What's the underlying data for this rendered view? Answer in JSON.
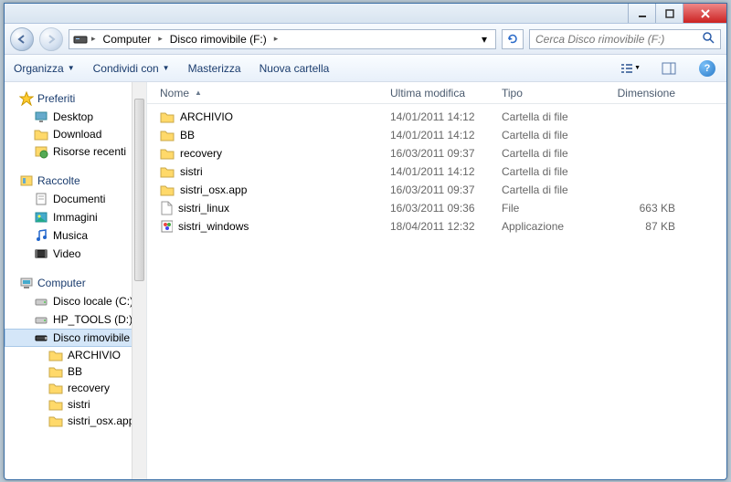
{
  "title_controls": {
    "min": "minimize",
    "max": "maximize",
    "close": "close"
  },
  "breadcrumb": {
    "items": [
      "Computer",
      "Disco rimovibile (F:)"
    ]
  },
  "search": {
    "placeholder": "Cerca Disco rimovibile (F:)"
  },
  "toolbar": {
    "organize": "Organizza",
    "share": "Condividi con",
    "burn": "Masterizza",
    "newfolder": "Nuova cartella"
  },
  "columns": {
    "name": "Nome",
    "date": "Ultima modifica",
    "type": "Tipo",
    "size": "Dimensione"
  },
  "sidebar": {
    "favorites": {
      "label": "Preferiti",
      "items": [
        {
          "label": "Desktop",
          "icon": "desktop"
        },
        {
          "label": "Download",
          "icon": "folder"
        },
        {
          "label": "Risorse recenti",
          "icon": "recent"
        }
      ]
    },
    "libraries": {
      "label": "Raccolte",
      "items": [
        {
          "label": "Documenti",
          "icon": "doc"
        },
        {
          "label": "Immagini",
          "icon": "img"
        },
        {
          "label": "Musica",
          "icon": "music"
        },
        {
          "label": "Video",
          "icon": "video"
        }
      ]
    },
    "computer": {
      "label": "Computer",
      "items": [
        {
          "label": "Disco locale (C:)",
          "icon": "hdd"
        },
        {
          "label": "HP_TOOLS (D:)",
          "icon": "hdd"
        },
        {
          "label": "Disco rimovibile (F:)",
          "icon": "usb",
          "selected": true,
          "children": [
            {
              "label": "ARCHIVIO"
            },
            {
              "label": "BB"
            },
            {
              "label": "recovery"
            },
            {
              "label": "sistri"
            },
            {
              "label": "sistri_osx.app"
            }
          ]
        }
      ]
    }
  },
  "files": [
    {
      "name": "ARCHIVIO",
      "date": "14/01/2011 14:12",
      "type": "Cartella di file",
      "size": "",
      "icon": "folder"
    },
    {
      "name": "BB",
      "date": "14/01/2011 14:12",
      "type": "Cartella di file",
      "size": "",
      "icon": "folder"
    },
    {
      "name": "recovery",
      "date": "16/03/2011 09:37",
      "type": "Cartella di file",
      "size": "",
      "icon": "folder"
    },
    {
      "name": "sistri",
      "date": "14/01/2011 14:12",
      "type": "Cartella di file",
      "size": "",
      "icon": "folder"
    },
    {
      "name": "sistri_osx.app",
      "date": "16/03/2011 09:37",
      "type": "Cartella di file",
      "size": "",
      "icon": "folder"
    },
    {
      "name": "sistri_linux",
      "date": "16/03/2011 09:36",
      "type": "File",
      "size": "663 KB",
      "icon": "file"
    },
    {
      "name": "sistri_windows",
      "date": "18/04/2011 12:32",
      "type": "Applicazione",
      "size": "87 KB",
      "icon": "app"
    }
  ]
}
